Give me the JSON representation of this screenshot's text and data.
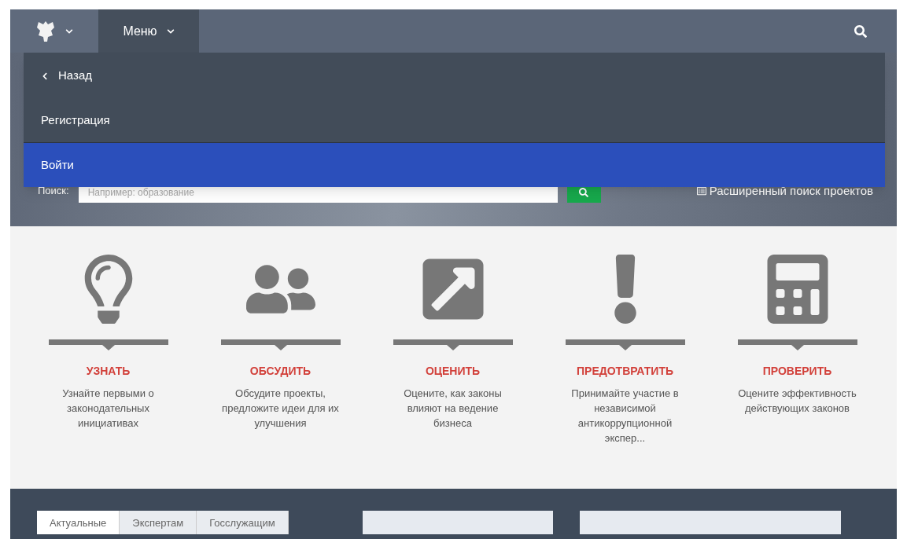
{
  "header": {
    "menu_label": "Меню"
  },
  "menu": {
    "back": "Назад",
    "items": [
      {
        "label": "Регистрация",
        "selected": false
      },
      {
        "label": "Войти",
        "selected": true
      }
    ]
  },
  "search": {
    "label": "Поиск:",
    "placeholder": "Например: образование",
    "advanced_link": "Расширенный поиск проектов"
  },
  "features": [
    {
      "kind": "bulb",
      "title": "УЗНАТЬ",
      "text": "Узнайте первыми о законодательных инициативах"
    },
    {
      "kind": "people",
      "title": "ОБСУДИТЬ",
      "text": "Обсудите проекты, предложите идеи для их улучшения"
    },
    {
      "kind": "share",
      "title": "ОЦЕНИТЬ",
      "text": "Оцените, как законы влияют на ведение бизнеса"
    },
    {
      "kind": "alert",
      "title": "ПРЕДОТВРАТИТЬ",
      "text": "Принимайте участие в независимой антикоррупционной экспер..."
    },
    {
      "kind": "calc",
      "title": "ПРОВЕРИТЬ",
      "text": "Оцените эффективность действующих законов"
    }
  ],
  "bottom_tabs": [
    {
      "label": "Актуальные",
      "selected": true
    },
    {
      "label": "Экспертам",
      "selected": false
    },
    {
      "label": "Госслужащим",
      "selected": false
    }
  ]
}
